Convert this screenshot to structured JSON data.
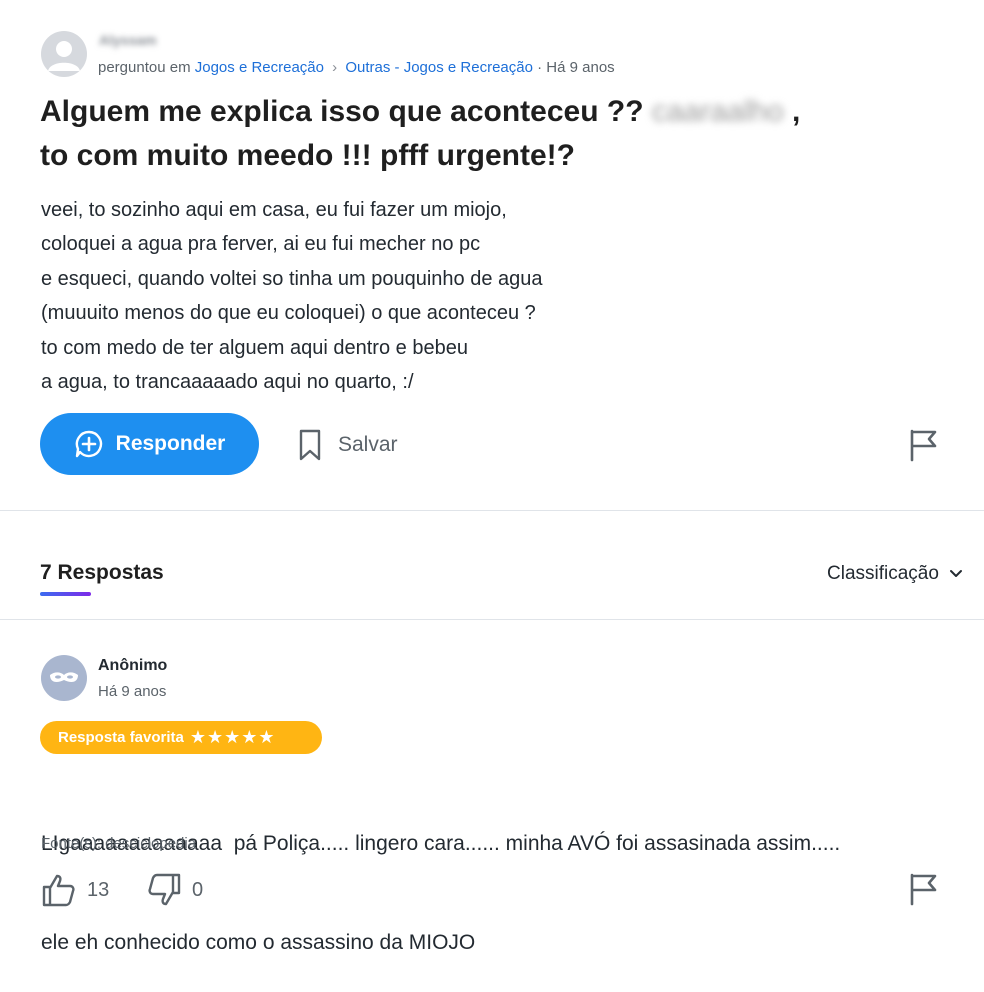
{
  "question": {
    "username": "Alyssam",
    "asked_prefix": "perguntou em",
    "category": "Jogos e Recreação",
    "subcategory": "Outras - Jogos e Recreação",
    "separator": "·",
    "time": "Há 9 anos",
    "title_part1": "Alguem me explica isso que aconteceu ??",
    "title_blurred": "caaraalho",
    "title_part2": ",",
    "title_line2": "to com muito meedo !!! pfff urgente!?",
    "body_lines": [
      "veei, to sozinho aqui em casa, eu fui fazer um miojo,",
      "coloquei a agua pra ferver, ai eu fui mecher no pc",
      "e esqueci, quando voltei so tinha um pouquinho de agua",
      "(muuuito menos do que eu coloquei) o que aconteceu ?",
      "to com medo de ter alguem aqui dentro e bebeu",
      "a agua, to trancaaaaado aqui no quarto, :/"
    ]
  },
  "actions": {
    "reply_label": "Responder",
    "save_label": "Salvar"
  },
  "answers_section": {
    "title": "7 Respostas",
    "sort_label": "Classificação"
  },
  "answer": {
    "author": "Anônimo",
    "time": "Há 9 anos",
    "badge_label": "Resposta favorita",
    "badge_stars": "★★★★★",
    "text_line1": "LIgaaaaaaaaaaaaa  pá Poliça..... lingero cara...... minha AVÓ foi assasinada assim.....",
    "text_line2": "ele eh conhecido como o assassino da MIOJO",
    "source": "Fonte(s): desciclopedia",
    "likes": "13",
    "dislikes": "0"
  },
  "colors": {
    "accent_blue": "#1e8ff0",
    "link_blue": "#1d6fd8",
    "badge_gold": "#ffb513"
  }
}
